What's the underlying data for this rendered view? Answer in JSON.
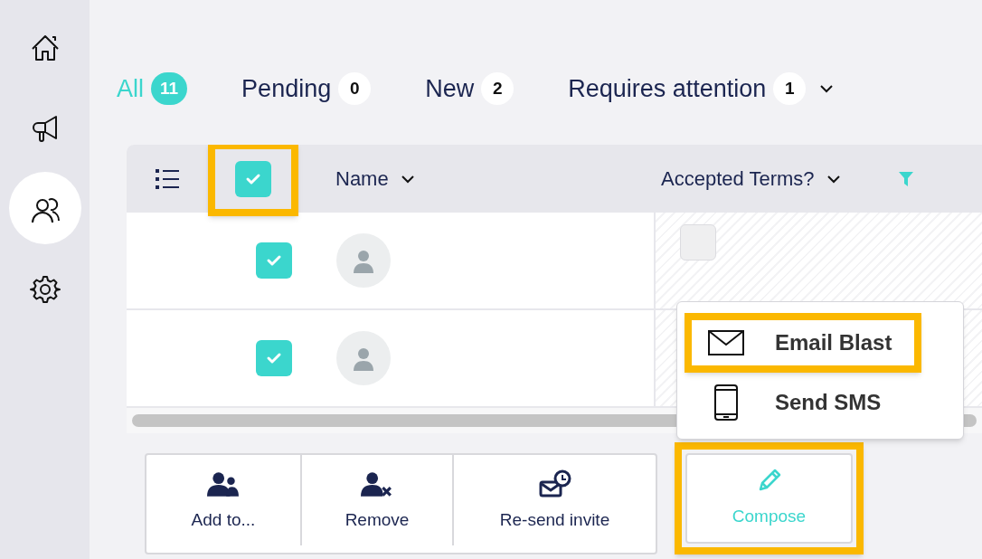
{
  "sidebar": {
    "items": [
      {
        "selected": false
      },
      {
        "selected": false
      },
      {
        "selected": true
      },
      {
        "selected": false
      }
    ]
  },
  "tabs": [
    {
      "label": "All",
      "count": "11",
      "selected": true
    },
    {
      "label": "Pending",
      "count": "0",
      "selected": false
    },
    {
      "label": "New",
      "count": "2",
      "selected": false
    },
    {
      "label": "Requires attention",
      "count": "1",
      "selected": false,
      "dropdown": true
    }
  ],
  "table": {
    "select_all": {
      "checked": true,
      "highlighted": true
    },
    "columns": [
      {
        "label": "Name",
        "sortable": true
      },
      {
        "label": "Accepted Terms?",
        "sortable": true,
        "filter": true
      }
    ],
    "rows": [
      {
        "checked": true,
        "accepted_terms": {
          "checked": false
        }
      },
      {
        "checked": true
      }
    ]
  },
  "actions": [
    {
      "kind": "add",
      "label": "Add to...",
      "highlighted": false
    },
    {
      "kind": "remove",
      "label": "Remove",
      "highlighted": false
    },
    {
      "kind": "resend",
      "label": "Re-send invite",
      "highlighted": false
    },
    {
      "kind": "compose",
      "label": "Compose",
      "highlighted": true
    }
  ],
  "compose_menu": {
    "items": [
      {
        "kind": "email",
        "label": "Email Blast",
        "highlighted": true
      },
      {
        "kind": "sms",
        "label": "Send SMS",
        "highlighted": false
      }
    ]
  }
}
